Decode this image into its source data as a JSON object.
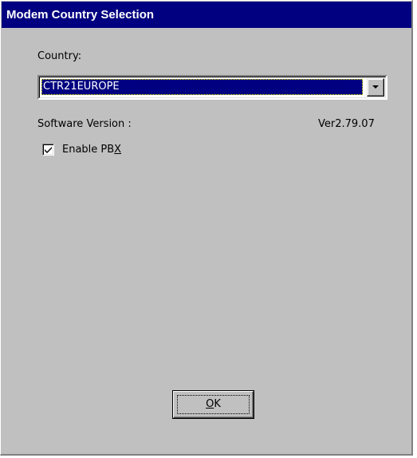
{
  "window": {
    "title": "Modem Country Selection"
  },
  "country": {
    "label": "Country:",
    "selected": "CTR21EUROPE"
  },
  "software_version": {
    "label": "Software Version :",
    "value": "Ver2.79.07"
  },
  "pbx": {
    "label_prefix": "Enable PB",
    "label_mnemonic": "X",
    "checked": true
  },
  "ok_button": {
    "mnemonic": "O",
    "rest": "K"
  },
  "colors": {
    "titlebar": "#000080",
    "face": "#c0c0c0",
    "selection": "#000080"
  },
  "icons": {
    "dropdown": "chevron-down-icon",
    "check": "checkmark-icon"
  }
}
